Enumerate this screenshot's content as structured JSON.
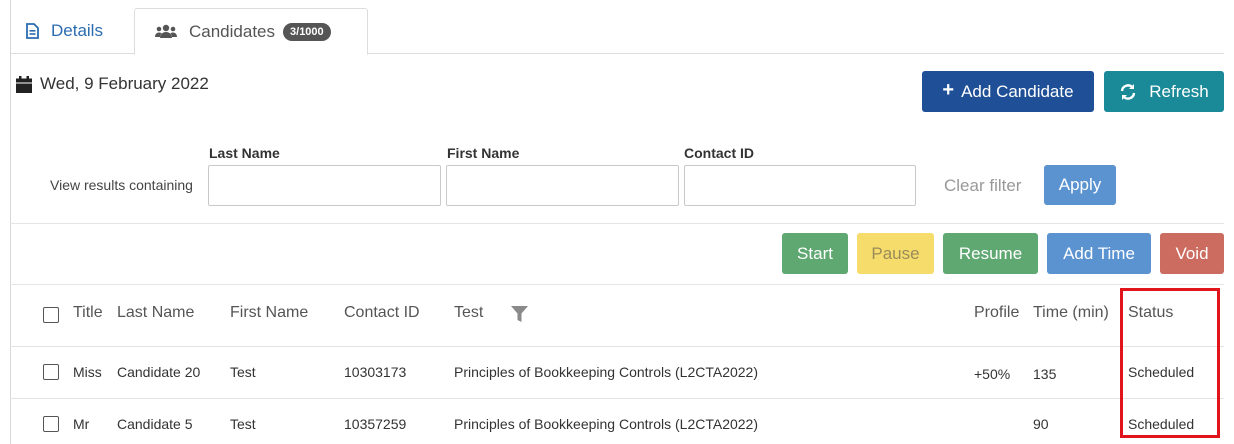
{
  "tabs": [
    {
      "label": "Details",
      "icon": "file-text-icon",
      "active": false
    },
    {
      "label": "Candidates",
      "icon": "users-icon",
      "badge": "3/1000",
      "active": true
    }
  ],
  "date": {
    "icon": "calendar-icon",
    "text": "Wed, 9 February 2022"
  },
  "toolbar": {
    "add_candidate_label": "Add Candidate",
    "refresh_label": "Refresh"
  },
  "filter": {
    "view_results_label": "View results containing",
    "last_name_label": "Last Name",
    "first_name_label": "First Name",
    "contact_id_label": "Contact ID",
    "last_name_value": "",
    "first_name_value": "",
    "contact_id_value": "",
    "clear_label": "Clear filter",
    "apply_label": "Apply"
  },
  "actions": {
    "start": "Start",
    "pause": "Pause",
    "resume": "Resume",
    "add_time": "Add Time",
    "void": "Void"
  },
  "table": {
    "headers": {
      "title": "Title",
      "last_name": "Last Name",
      "first_name": "First Name",
      "contact_id": "Contact ID",
      "test": "Test",
      "profile": "Profile",
      "time": "Time (min)",
      "status": "Status"
    },
    "rows": [
      {
        "title": "Miss",
        "last_name": "Candidate 20",
        "first_name": "Test",
        "contact_id": "10303173",
        "test": "Principles of Bookkeeping Controls (L2CTA2022)",
        "profile": "+50%",
        "time": "135",
        "status": "Scheduled"
      },
      {
        "title": "Mr",
        "last_name": "Candidate 5",
        "first_name": "Test",
        "contact_id": "10357259",
        "test": "Principles of Bookkeeping Controls (L2CTA2022)",
        "profile": "",
        "time": "90",
        "status": "Scheduled"
      }
    ]
  },
  "colors": {
    "primary": "#1f4f96",
    "teal": "#1a8a99",
    "green": "#5fa872",
    "yellow": "#f6dc6b",
    "blue": "#5b93d1",
    "red": "#cc6b5f",
    "highlight": "#e0141a"
  }
}
